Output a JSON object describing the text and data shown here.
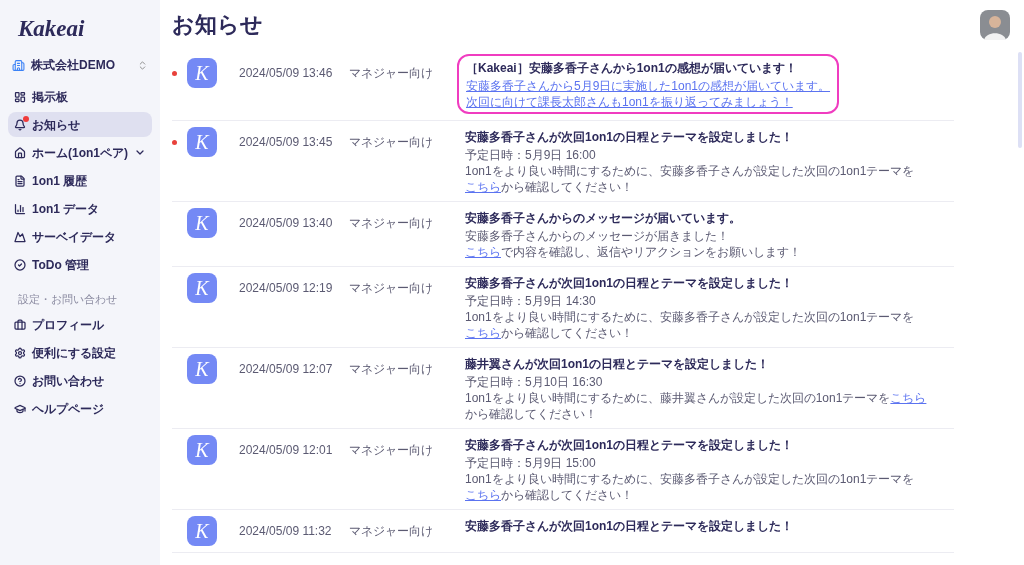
{
  "sidebar": {
    "logo": "Kakeai",
    "organization": "株式会社DEMO",
    "items": [
      {
        "label": "掲示板",
        "kind": "link",
        "selected": false,
        "badge": false
      },
      {
        "label": "お知らせ",
        "kind": "link",
        "selected": true,
        "badge": true
      },
      {
        "label": "ホーム(1on1ペア)",
        "kind": "group",
        "selected": false,
        "badge": false
      },
      {
        "label": "1on1 履歴",
        "kind": "link",
        "selected": false,
        "badge": false
      },
      {
        "label": "1on1 データ",
        "kind": "link",
        "selected": false,
        "badge": false
      },
      {
        "label": "サーベイデータ",
        "kind": "link",
        "selected": false,
        "badge": false
      },
      {
        "label": "ToDo 管理",
        "kind": "link",
        "selected": false,
        "badge": false
      }
    ],
    "section_title": "設定・お問い合わせ",
    "settings_items": [
      {
        "label": "プロフィール",
        "selected": false
      },
      {
        "label": "便利にする設定",
        "selected": false
      },
      {
        "label": "お問い合わせ",
        "selected": false
      },
      {
        "label": "ヘルプページ",
        "selected": false
      }
    ]
  },
  "page_title": "お知らせ",
  "notifications": [
    {
      "unread": true,
      "highlighted": true,
      "icon_letter": "K",
      "date": "2024/05/09 13:46",
      "audience": "マネジャー向け",
      "title": "［Kakeai］安藤多香子さんから1on1の感想が届いています！",
      "body": [
        {
          "link": "安藤多香子さんから5月9日に実施した1on1の感想が届いています。"
        },
        {
          "link": "次回に向けて課長太郎さんも1on1を振り返ってみましょう！"
        }
      ]
    },
    {
      "unread": true,
      "highlighted": false,
      "icon_letter": "K",
      "date": "2024/05/09 13:45",
      "audience": "マネジャー向け",
      "title": "安藤多香子さんが次回1on1の日程とテーマを設定しました！",
      "body": [
        {
          "text": "予定日時：5月9日 16:00"
        },
        {
          "text": "1on1をより良い時間にするために、安藤多香子さんが設定した次回の1on1テーマを",
          "link": "こちら",
          "after": "から確認してください！"
        }
      ]
    },
    {
      "unread": false,
      "highlighted": false,
      "icon_letter": "K",
      "date": "2024/05/09 13:40",
      "audience": "マネジャー向け",
      "title": "安藤多香子さんからのメッセージが届いています。",
      "body": [
        {
          "text": "安藤多香子さんからのメッセージが届きました！"
        },
        {
          "link": "こちら",
          "after": "で内容を確認し、返信やリアクションをお願いします！"
        }
      ]
    },
    {
      "unread": false,
      "highlighted": false,
      "icon_letter": "K",
      "date": "2024/05/09 12:19",
      "audience": "マネジャー向け",
      "title": "安藤多香子さんが次回1on1の日程とテーマを設定しました！",
      "body": [
        {
          "text": "予定日時：5月9日 14:30"
        },
        {
          "text": "1on1をより良い時間にするために、安藤多香子さんが設定した次回の1on1テーマを",
          "link": "こちら",
          "after": "から確認してください！"
        }
      ]
    },
    {
      "unread": false,
      "highlighted": false,
      "icon_letter": "K",
      "date": "2024/05/09 12:07",
      "audience": "マネジャー向け",
      "title": "藤井翼さんが次回1on1の日程とテーマを設定しました！",
      "body": [
        {
          "text": "予定日時：5月10日 16:30"
        },
        {
          "text": "1on1をより良い時間にするために、藤井翼さんが設定した次回の1on1テーマを",
          "link": "こちら",
          "after": "から確認してください！"
        }
      ]
    },
    {
      "unread": false,
      "highlighted": false,
      "icon_letter": "K",
      "date": "2024/05/09 12:01",
      "audience": "マネジャー向け",
      "title": "安藤多香子さんが次回1on1の日程とテーマを設定しました！",
      "body": [
        {
          "text": "予定日時：5月9日 15:00"
        },
        {
          "text": "1on1をより良い時間にするために、安藤多香子さんが設定した次回の1on1テーマを",
          "link": "こちら",
          "after": "から確認してください！"
        }
      ]
    },
    {
      "unread": false,
      "highlighted": false,
      "icon_letter": "K",
      "date": "2024/05/09 11:32",
      "audience": "マネジャー向け",
      "title": "安藤多香子さんが次回1on1の日程とテーマを設定しました！"
    }
  ]
}
